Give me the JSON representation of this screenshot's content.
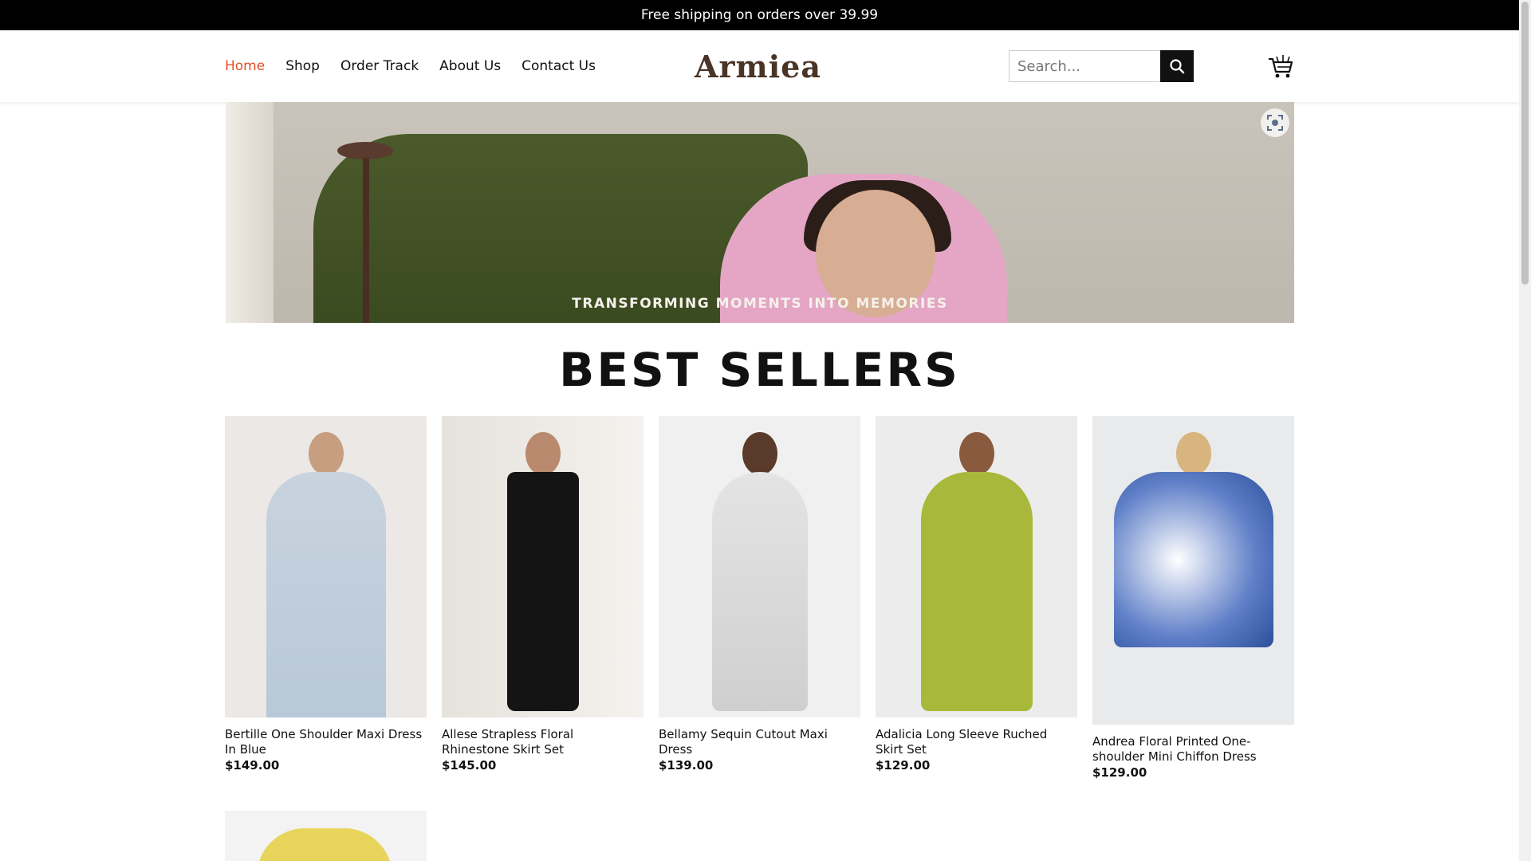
{
  "announcement": "Free shipping on orders over 39.99",
  "nav": {
    "items": [
      {
        "label": "Home",
        "active": true
      },
      {
        "label": "Shop"
      },
      {
        "label": "Order Track"
      },
      {
        "label": "About Us"
      },
      {
        "label": "Contact Us"
      }
    ]
  },
  "logo": "Armiea",
  "search": {
    "placeholder": "Search...",
    "icon": "search-icon"
  },
  "cart": {
    "icon": "cart-icon"
  },
  "hero": {
    "caption": "TRANSFORMING MOMENTS INTO MEMORIES",
    "icon": "lens-icon"
  },
  "best_sellers": {
    "title": "BEST SELLERS",
    "products": [
      {
        "name": "Bertille One Shoulder Maxi Dress In Blue",
        "price": "$149.00"
      },
      {
        "name": "Allese Strapless Floral Rhinestone Skirt Set",
        "price": "$145.00"
      },
      {
        "name": "Bellamy Sequin Cutout Maxi Dress",
        "price": "$139.00"
      },
      {
        "name": "Adalicia Long Sleeve Ruched Skirt Set",
        "price": "$129.00"
      },
      {
        "name": "Andrea Floral Printed One-shoulder Mini Chiffon Dress",
        "price": "$129.00"
      }
    ]
  },
  "colors": {
    "accent": "#e2502a",
    "topbar": "#000000",
    "logo": "#4a3426"
  }
}
